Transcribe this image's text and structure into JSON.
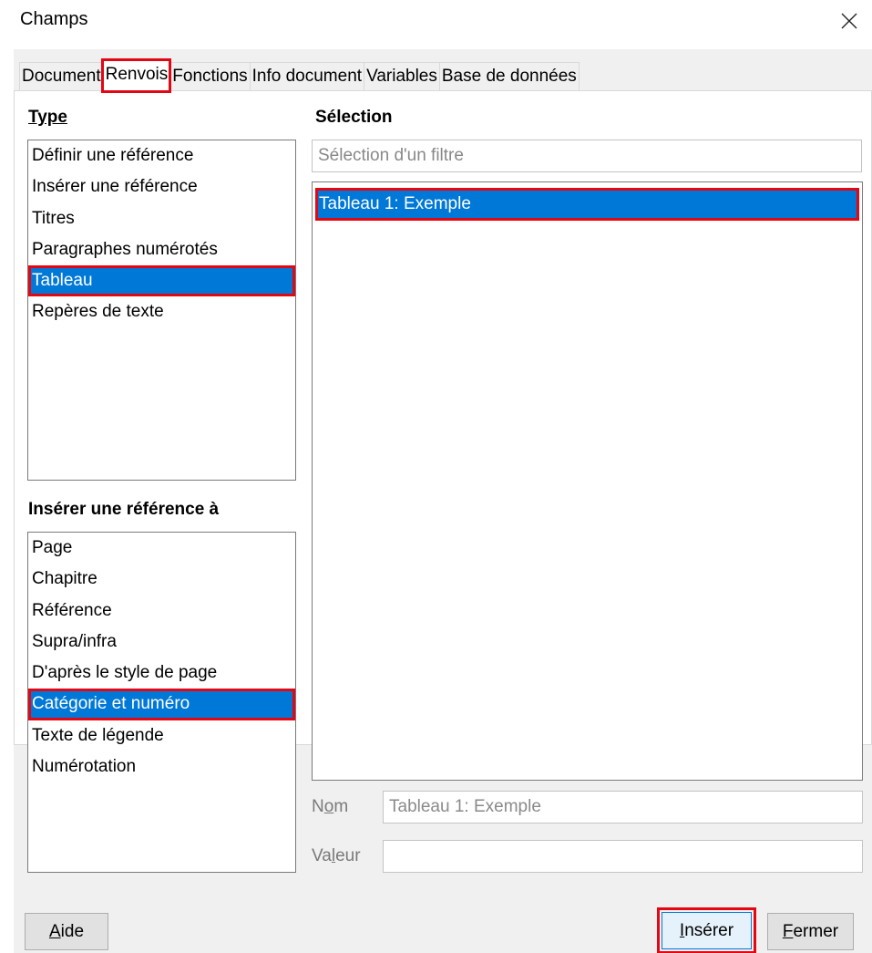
{
  "window": {
    "title": "Champs"
  },
  "tabs": [
    {
      "label": "Document"
    },
    {
      "label": "Renvois",
      "active": true
    },
    {
      "label": "Fonctions"
    },
    {
      "label": "Info document"
    },
    {
      "label": "Variables"
    },
    {
      "label": "Base de données"
    }
  ],
  "type_panel": {
    "label": "Type",
    "items": [
      "Définir une référence",
      "Insérer une référence",
      "Titres",
      "Paragraphes numérotés",
      "Tableau",
      "Repères de texte"
    ],
    "selected": "Tableau"
  },
  "insert_ref_panel": {
    "label": "Insérer une référence à",
    "items": [
      "Page",
      "Chapitre",
      "Référence",
      "Supra/infra",
      "D'après le style de page",
      "Catégorie et numéro",
      "Texte de légende",
      "Numérotation"
    ],
    "selected": "Catégorie et numéro"
  },
  "selection_panel": {
    "label": "Sélection",
    "filter_placeholder": "Sélection d'un filtre",
    "items": [
      "Tableau 1: Exemple"
    ],
    "selected": "Tableau 1: Exemple"
  },
  "fields": {
    "nom_label": "Nom",
    "nom_value": "Tableau 1: Exemple",
    "valeur_label": "Valeur",
    "valeur_value": ""
  },
  "buttons": {
    "help": "Aide",
    "insert": "Insérer",
    "close": "Fermer"
  },
  "colors": {
    "selection": "#0078d7",
    "highlight": "#e30613"
  },
  "icons": {
    "close": "close-icon"
  }
}
